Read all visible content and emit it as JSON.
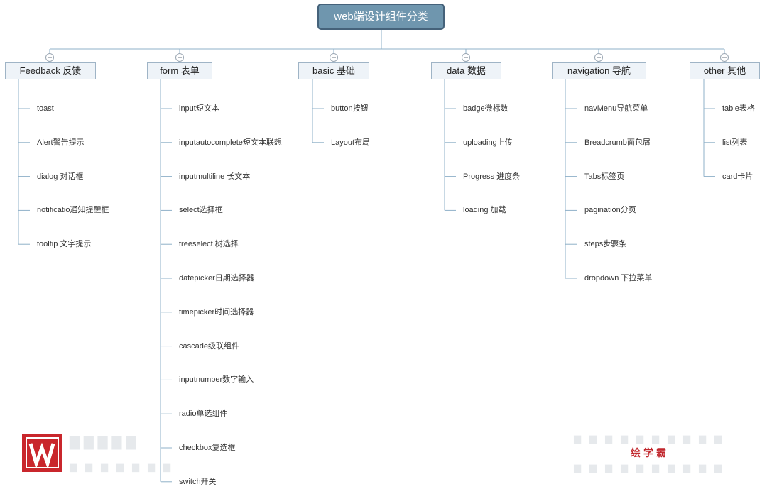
{
  "diagram": {
    "root": "web端设计组件分类",
    "categories": [
      {
        "label": "Feedback 反馈",
        "items": [
          "toast",
          "Alert警告提示",
          "dialog 对话框",
          "notificatio通知提醒框",
          "tooltip 文字提示"
        ]
      },
      {
        "label": "form 表单",
        "items": [
          "input短文本",
          "inputautocomplete短文本联想",
          "inputmultiline 长文本",
          "select选择框",
          "treeselect 树选择",
          "datepicker日期选择器",
          "timepicker时间选择器",
          "cascade级联组件",
          "inputnumber数字输入",
          "radio单选组件",
          "checkbox复选框",
          "switch开关"
        ]
      },
      {
        "label": "basic 基础",
        "items": [
          "button按钮",
          "Layout布局"
        ]
      },
      {
        "label": "data 数据",
        "items": [
          "badge微标数",
          "uploading上传",
          "Progress 进度条",
          "loading 加载"
        ]
      },
      {
        "label": "navigation 导航",
        "items": [
          "navMenu导航菜单",
          "Breadcrumb面包屑",
          "Tabs标签页",
          "pagination分页",
          "steps步骤条",
          "dropdown 下拉菜单"
        ]
      },
      {
        "label": "other 其他",
        "items": [
          "table表格",
          "list列表",
          "card卡片"
        ]
      }
    ]
  },
  "watermark": {
    "logo_letter": "W",
    "brand": "绘学霸"
  },
  "colors": {
    "root_fill": "#6f96ae",
    "root_border": "#45627a",
    "category_fill": "#eef3f8",
    "category_border": "#9fb4c6",
    "connector": "#8fb0c8",
    "logo_red": "#c9262c",
    "brand_red": "#c1272d"
  }
}
